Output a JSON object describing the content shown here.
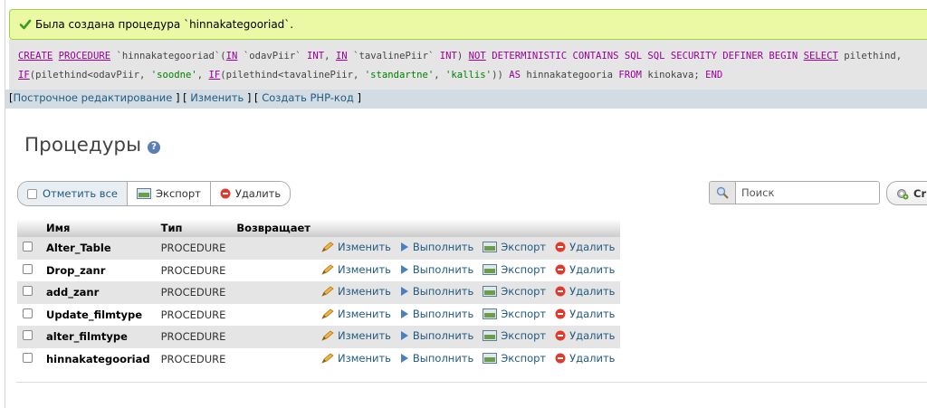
{
  "message": {
    "text": "Была создана процедура `hinnakategooriad`."
  },
  "sql": {
    "create": "CREATE",
    "procedure": "PROCEDURE",
    "routine_name": "`hinnakategooriad`",
    "in1": "IN",
    "param1": "`odavPiir`",
    "int1": "INT",
    "in2": "IN",
    "param2": "`tavalinePiir`",
    "int2": "INT",
    "not": "NOT",
    "rest_kw": "DETERMINISTIC CONTAINS SQL SQL SECURITY DEFINER BEGIN",
    "select": "SELECT",
    "col1": "pilethind,",
    "if1": "IF",
    "cond1": "(pilethind<odavPiir, ",
    "s1": "'soodne'",
    "if2": "IF",
    "cond2": "(pilethind<tavalinePiir, ",
    "s2": "'standartne'",
    "s3": "'kallis'",
    "as": "AS",
    "alias": "hinnakategooria",
    "from": "FROM",
    "table": "kinokava;",
    "end": "END"
  },
  "tools": {
    "inline_edit": "Построчное редактирование",
    "edit": "Изменить",
    "php": "Создать PHP-код"
  },
  "page": {
    "title": "Процедуры"
  },
  "toolbar": {
    "check_all": "Отметить все",
    "export": "Экспорт",
    "delete": "Удалить",
    "search_placeholder": "Поиск",
    "create": "Cr"
  },
  "table": {
    "headers": [
      "Имя",
      "Тип",
      "Возвращает"
    ],
    "action_labels": {
      "edit": "Изменить",
      "execute": "Выполнить",
      "export": "Экспорт",
      "drop": "Удалить"
    },
    "rows": [
      {
        "name": "Alter_Table",
        "type": "PROCEDURE",
        "returns": ""
      },
      {
        "name": "Drop_zanr",
        "type": "PROCEDURE",
        "returns": ""
      },
      {
        "name": "add_zanr",
        "type": "PROCEDURE",
        "returns": ""
      },
      {
        "name": "Update_filmtype",
        "type": "PROCEDURE",
        "returns": ""
      },
      {
        "name": "alter_filmtype",
        "type": "PROCEDURE",
        "returns": ""
      },
      {
        "name": "hinnakategooriad",
        "type": "PROCEDURE",
        "returns": ""
      }
    ]
  },
  "colors": {
    "link": "#235a81",
    "success_bg": "#ebf8a4",
    "success_border": "#a2d246",
    "keyword": "#990099",
    "string": "#008000"
  }
}
